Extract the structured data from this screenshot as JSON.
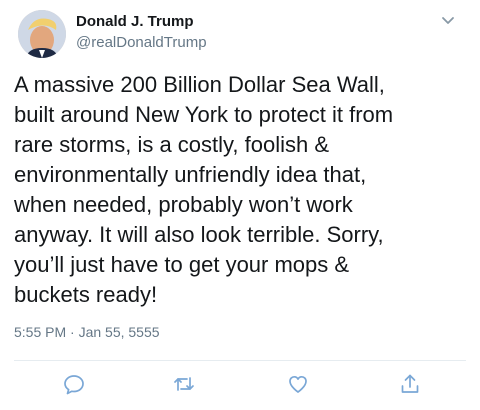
{
  "author": {
    "display_name": "Donald J. Trump",
    "handle": "@realDonaldTrump",
    "avatar_icon": "profile-photo"
  },
  "tweet": {
    "text": "A massive 200 Billion Dollar Sea Wall,\nbuilt around New York to protect it from\nrare storms, is a costly, foolish &\nenvironmentally unfriendly idea that,\nwhen needed, probably won’t work\nanyway. It will also look terrible. Sorry,\nyou’ll just have to get your mops &\nbuckets ready!",
    "timestamp": "5:55 PM · Jan 55, 5555"
  },
  "icons": {
    "menu": "chevron-down-icon",
    "reply": "reply-icon",
    "retweet": "retweet-icon",
    "like": "heart-icon",
    "share": "share-icon"
  },
  "colors": {
    "text": "#14171a",
    "secondary": "#657786",
    "icon": "#7aa7d6",
    "divider": "#e6ecf0"
  }
}
